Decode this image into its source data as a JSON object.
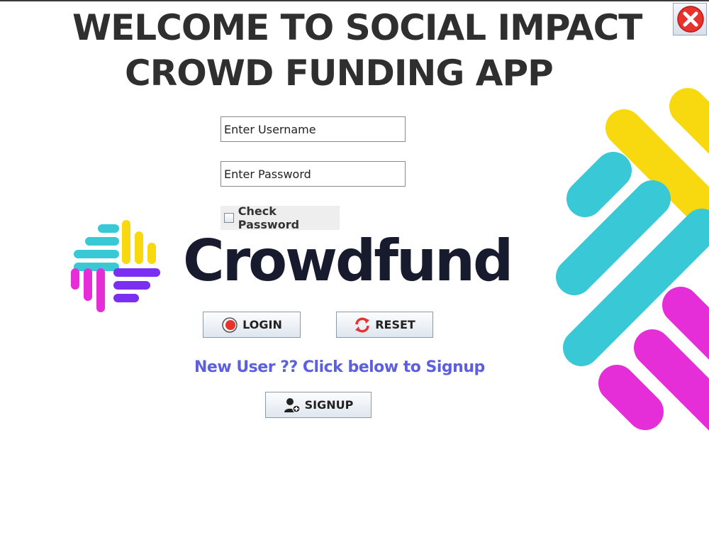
{
  "header": {
    "title_line1": "WELCOME TO SOCIAL IMPACT",
    "title_line2": "CROWD FUNDING APP"
  },
  "window": {
    "close_icon": "close-icon",
    "close_color": "#e8322d"
  },
  "form": {
    "username_placeholder": "Enter Username",
    "password_placeholder": "Enter Password",
    "check_password_label": "Check Password"
  },
  "brand": {
    "wordmark": "Crowdfund",
    "colors": {
      "cyan": "#38c8d6",
      "yellow": "#f8d90f",
      "purple": "#7b2ff0",
      "magenta": "#e52ed8",
      "dark": "#181a2e"
    }
  },
  "buttons": {
    "login_label": "LOGIN",
    "reset_label": "RESET",
    "signup_label": "SIGNUP"
  },
  "signup_prompt": "New User ?? Click below to Signup"
}
